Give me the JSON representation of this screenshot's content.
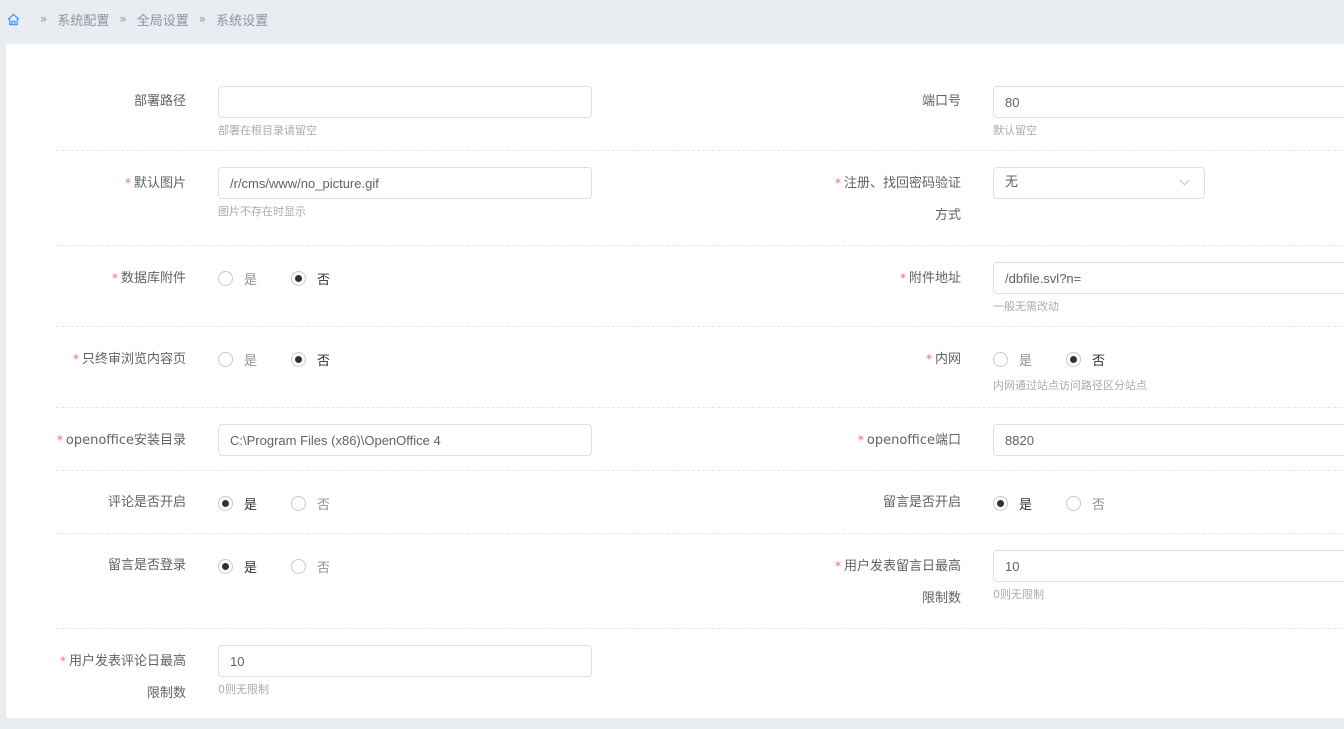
{
  "breadcrumb": {
    "items": [
      "系统配置",
      "全局设置",
      "系统设置"
    ]
  },
  "yes": "是",
  "no": "否",
  "fields": {
    "deploy_path": {
      "label": "部署路径",
      "value": "",
      "hint": "部署在根目录请留空"
    },
    "port": {
      "label": "端口号",
      "value": "80",
      "hint": "默认留空"
    },
    "default_picture": {
      "label": "默认图片",
      "value": "/r/cms/www/no_picture.gif",
      "hint": "图片不存在时显示"
    },
    "verify_mode": {
      "label": "注册、找回密码验证方式",
      "value": "无"
    },
    "db_attachment": {
      "label": "数据库附件",
      "selected": "否"
    },
    "attachment_url": {
      "label": "附件地址",
      "value": "/dbfile.svl?n=",
      "hint": "一般无需改动"
    },
    "final_review_only": {
      "label": "只终审浏览内容页",
      "selected": "否"
    },
    "intranet": {
      "label": "内网",
      "selected": "否",
      "hint": "内网通过站点访问路径区分站点"
    },
    "openoffice_dir": {
      "label": "openoffice安装目录",
      "value": "C:\\Program Files (x86)\\OpenOffice 4"
    },
    "openoffice_port": {
      "label": "openoffice端口",
      "value": "8820"
    },
    "comment_open": {
      "label": "评论是否开启",
      "selected": "是"
    },
    "guestbook_open": {
      "label": "留言是否开启",
      "selected": "是"
    },
    "guestbook_login": {
      "label": "留言是否登录",
      "selected": "是"
    },
    "guestbook_daily_limit": {
      "label": "用户发表留言日最高限制数",
      "value": "10",
      "hint": "0则无限制"
    },
    "comment_daily_limit": {
      "label": "用户发表评论日最高 限制数",
      "value": "10",
      "hint": "0则无限制"
    }
  }
}
